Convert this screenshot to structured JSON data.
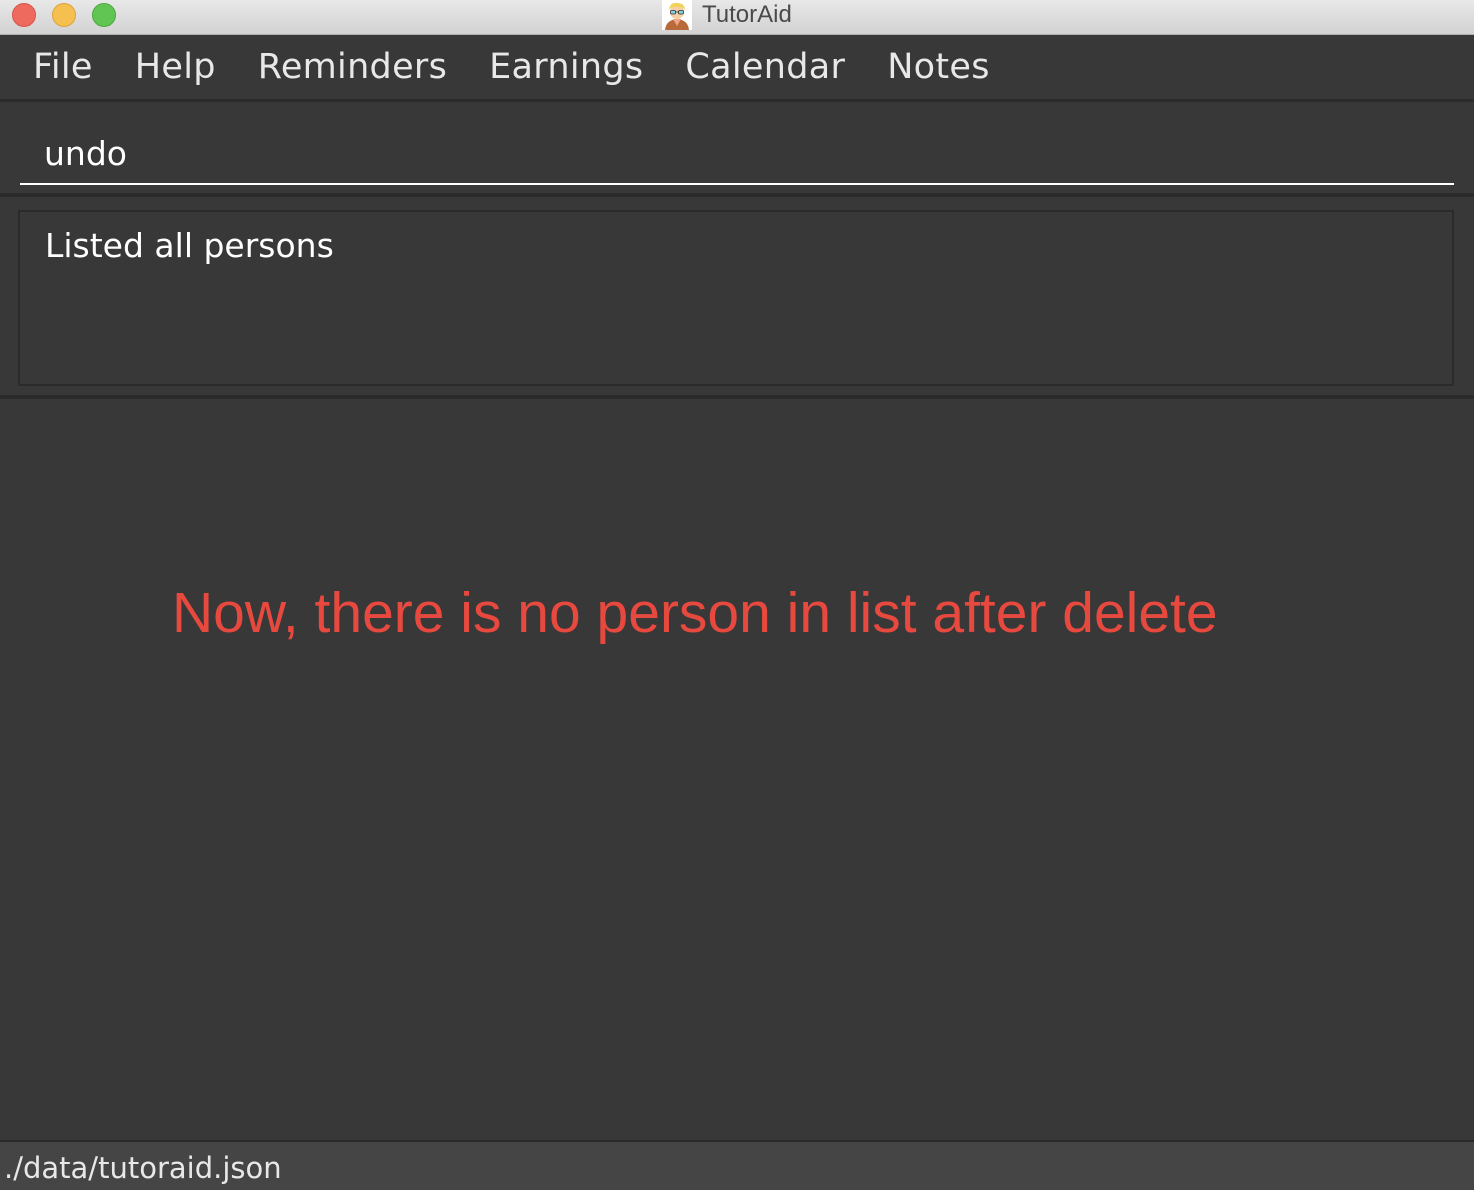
{
  "window": {
    "title": "TutorAid",
    "app_icon": "tutor-avatar-icon",
    "controls": [
      "close",
      "minimize",
      "maximize"
    ]
  },
  "menubar": {
    "items": [
      {
        "label": "File"
      },
      {
        "label": "Help"
      },
      {
        "label": "Reminders"
      },
      {
        "label": "Earnings"
      },
      {
        "label": "Calendar"
      },
      {
        "label": "Notes"
      }
    ]
  },
  "command_box": {
    "value": "undo"
  },
  "result_display": {
    "text": "Listed all persons"
  },
  "person_list": {
    "items": []
  },
  "annotation": {
    "text": "Now, there is no person in list after delete",
    "color": "#e8493f"
  },
  "status_bar": {
    "file_path": "./data/tutoraid.json"
  }
}
